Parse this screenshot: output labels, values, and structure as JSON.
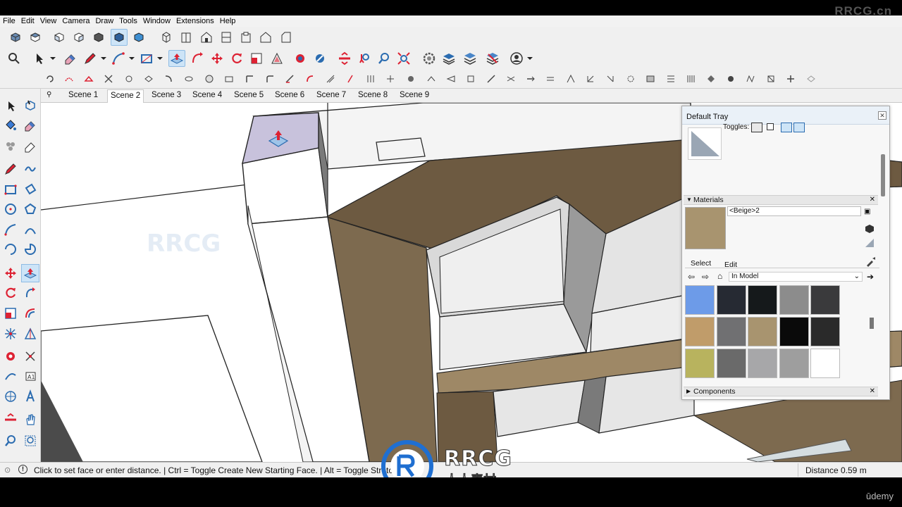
{
  "watermark": {
    "top_text": "RRCG.cn",
    "logo_text": "RRCG",
    "logo_subtext": "人人素材"
  },
  "menu": [
    "File",
    "Edit",
    "View",
    "Camera",
    "Draw",
    "Tools",
    "Window",
    "Extensions",
    "Help"
  ],
  "toolbar_icons": {
    "row1": [
      "iso-view-icon",
      "top-view-icon",
      "front-view-icon",
      "right-view-icon",
      "back-view-icon",
      "left-view-icon",
      "bottom-view-icon",
      "xray-style-icon",
      "wireframe-style-icon",
      "hidden-line-style-icon",
      "shaded-style-icon",
      "shaded-texture-style-icon",
      "monochrome-style-icon"
    ],
    "row2": [
      "search-icon",
      "select-arrow-icon",
      "eraser-icon",
      "pencil-icon",
      "arc-icon",
      "rectangle-icon",
      "push-pull-icon",
      "follow-me-icon",
      "move-icon",
      "rotate-icon",
      "scale-icon",
      "offset-icon",
      "paint-bucket-icon",
      "sample-paint-icon",
      "section-plane-icon",
      "walk-icon",
      "zoom-icon",
      "zoom-extents-icon",
      "gear-icon",
      "layers-icon",
      "layers-icon",
      "layers-icon",
      "user-account-icon"
    ]
  },
  "scenes": [
    "Scene 1",
    "Scene 2",
    "Scene 3",
    "Scene 4",
    "Scene 5",
    "Scene 6",
    "Scene 7",
    "Scene 8",
    "Scene 9"
  ],
  "active_scene": "Scene 2",
  "tray": {
    "title": "Default Tray",
    "toggles_label": "Toggles:",
    "materials_header": "Materials",
    "material_name": "<Beige>2",
    "tab_select": "Select",
    "tab_edit": "Edit",
    "library": "In Model",
    "components_header": "Components",
    "current_color": "#a8946f",
    "swatches": [
      "#6d9be8",
      "#262a33",
      "#15191b",
      "#8c8c8c",
      "#3a3a3c",
      "#c09c6a",
      "#707072",
      "#a8946f",
      "#0a0a0a",
      "#2a2a2a",
      "#b8b35e",
      "#6a6a6a",
      "#a7a7a9",
      "#9e9e9e",
      "#ffffff"
    ]
  },
  "status": {
    "text": "Click to set face or enter distance. | Ctrl = Toggle Create New Starting Face. | Alt = Toggle Stretch",
    "measure_label": "Distance",
    "measure_value": "0.59 m"
  },
  "brand": "ūdemy",
  "colors": {
    "accent": "#cde4f7",
    "wood": "#7d6a4f",
    "wood_light": "#9e8866",
    "panel": "#f0f0f0"
  }
}
